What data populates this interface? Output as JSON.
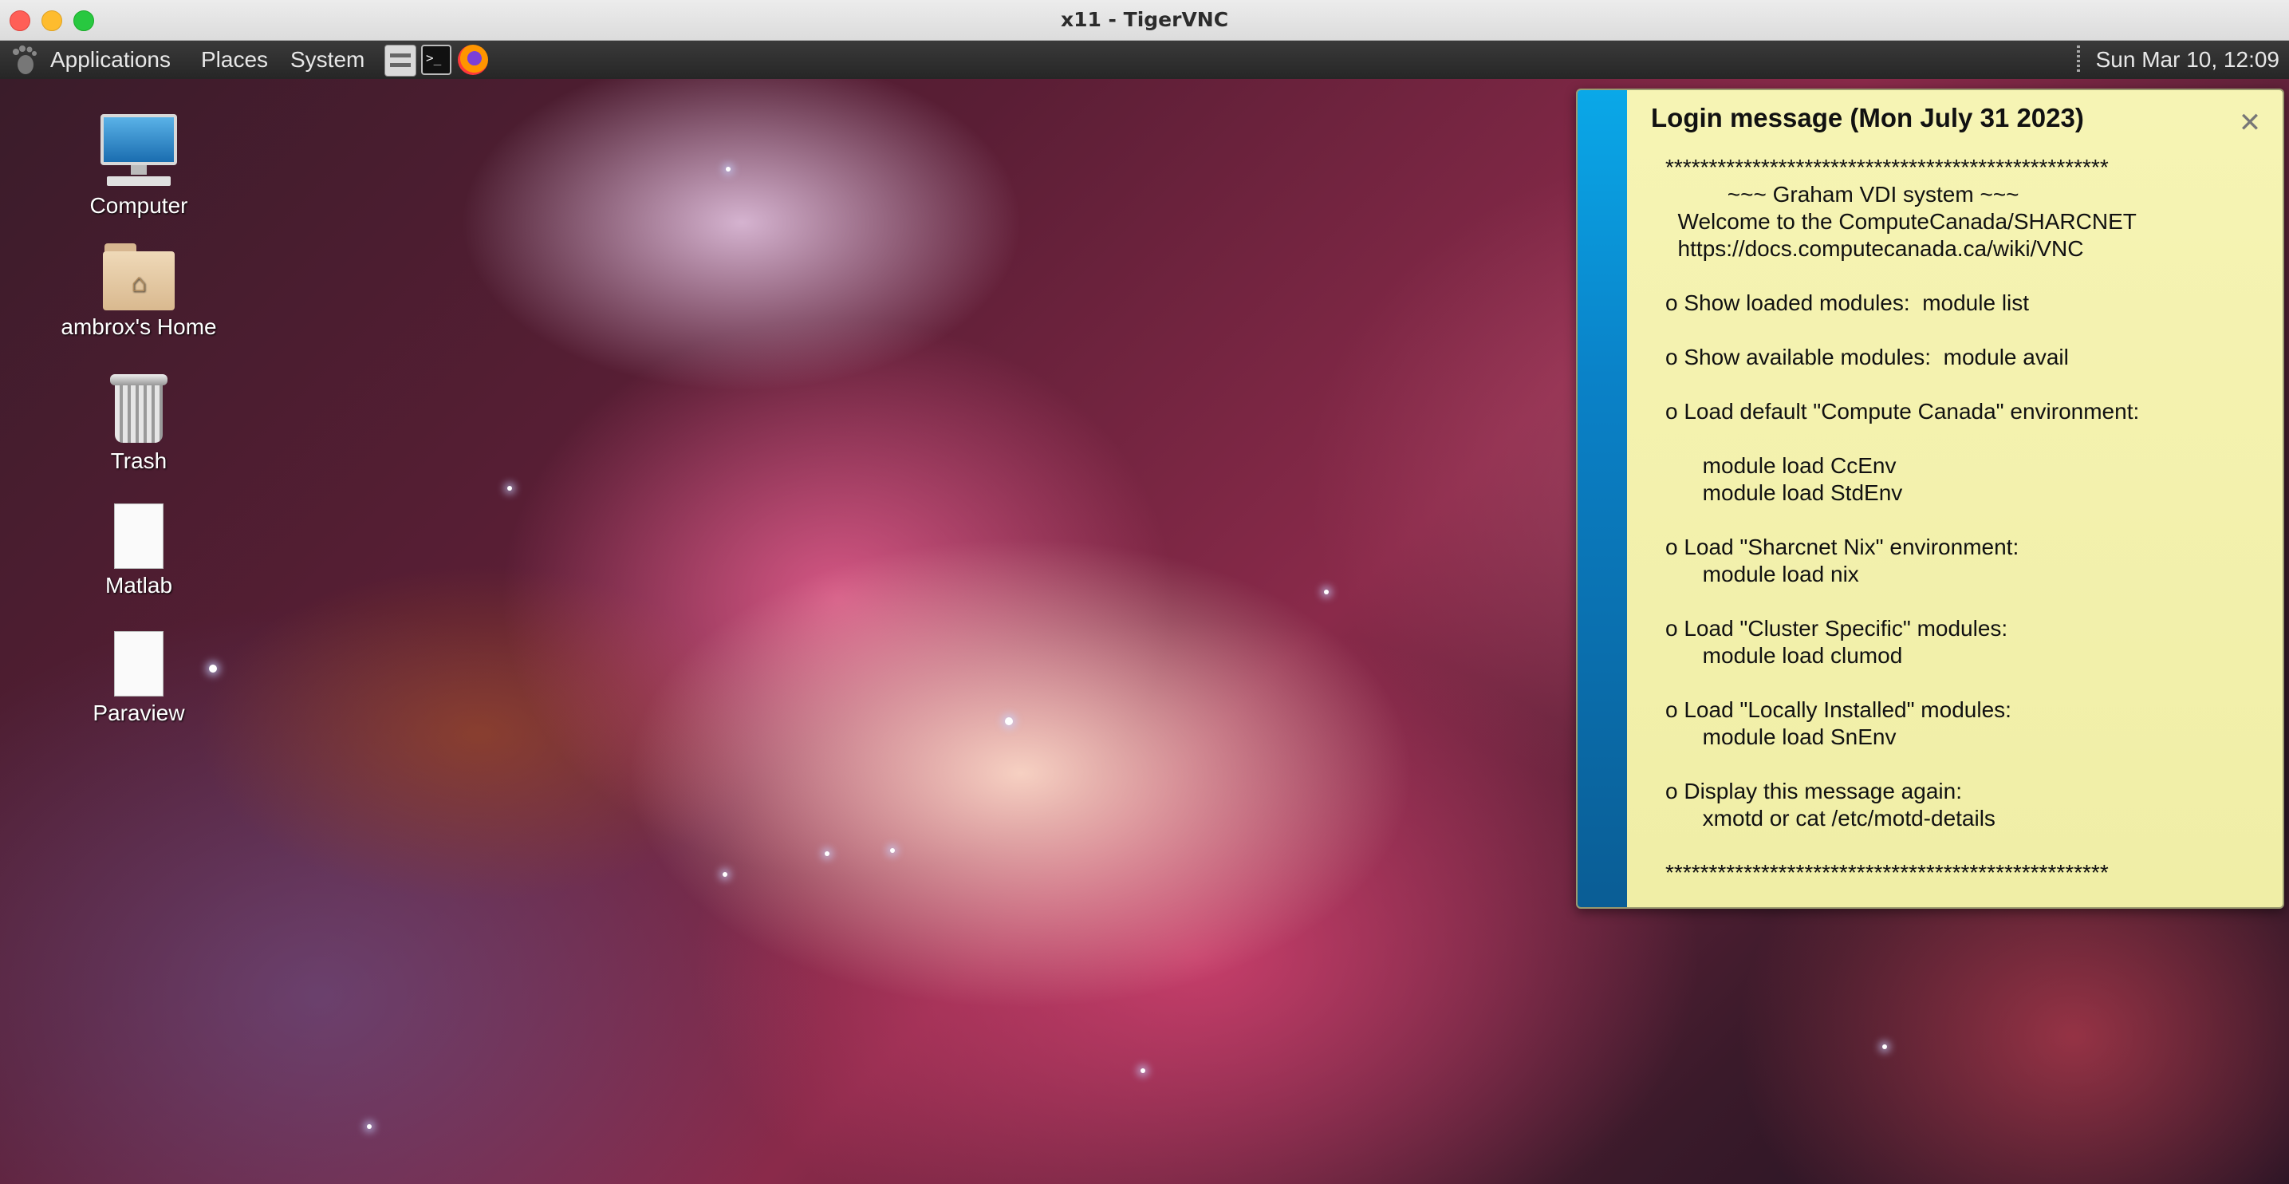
{
  "window": {
    "title": "x11 - TigerVNC"
  },
  "panel": {
    "menus": [
      "Applications",
      "Places",
      "System"
    ],
    "clock": "Sun Mar 10, 12:09",
    "launchers": [
      {
        "icon": "file-manager-icon"
      },
      {
        "icon": "terminal-icon"
      },
      {
        "icon": "firefox-icon"
      }
    ]
  },
  "desktop_icons": [
    {
      "label": "Computer",
      "icon": "computer-icon"
    },
    {
      "label": "ambrox's Home",
      "icon": "home-folder-icon"
    },
    {
      "label": "Trash",
      "icon": "trash-icon"
    },
    {
      "label": "Matlab",
      "icon": "file-icon"
    },
    {
      "label": "Paraview",
      "icon": "file-icon"
    }
  ],
  "login_message": {
    "title": "Login message (Mon July 31 2023)",
    "lines": [
      "***************************************************",
      "          ~~~ Graham VDI system ~~~",
      "  Welcome to the ComputeCanada/SHARCNET",
      "  https://docs.computecanada.ca/wiki/VNC",
      "",
      "o Show loaded modules:  module list",
      "",
      "o Show available modules:  module avail",
      "",
      "o Load default \"Compute Canada\" environment:",
      "",
      "      module load CcEnv",
      "      module load StdEnv",
      "",
      "o Load \"Sharcnet Nix\" environment:",
      "      module load nix",
      "",
      "o Load \"Cluster Specific\" modules:",
      "      module load clumod",
      "",
      "o Load \"Locally Installed\" modules:",
      "      module load SnEnv",
      "",
      "o Display this message again:",
      "      xmotd or cat /etc/motd-details",
      "",
      "***************************************************"
    ]
  },
  "colors": {
    "panel_bg": "#2e2e2e",
    "motd_bg": "#f4f2b0",
    "motd_stripe": "#0a82c8"
  }
}
